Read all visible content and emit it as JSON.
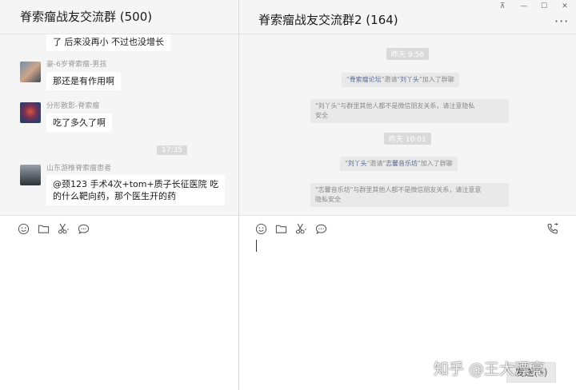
{
  "left": {
    "title": "脊索瘤战友交流群 (500)",
    "messages": [
      {
        "text": "了  后来没再小  不过也没增长"
      },
      {
        "sender": "豪-6岁脊索瘤-男孩",
        "text": "那还是有作用啊"
      },
      {
        "sender": "分形散影-脊索瘤",
        "text": "吃了多久了啊"
      },
      {
        "time": "17:35"
      },
      {
        "sender": "山东游椎脊索瘤患者",
        "text_line1": "@颈123  手术4次+tom+质子长征医院 吃",
        "text_line2": "的什么靶向药，那个医生开的药"
      }
    ]
  },
  "right": {
    "title": "脊索瘤战友交流群2 (164)",
    "more_label": "···",
    "messages": [
      {
        "time": "昨天 9:56"
      },
      {
        "q1": "\"",
        "inviter": "脊索瘤论坛",
        "q2": "\"邀请\"",
        "invitee": "刘丫头",
        "q3": "\"加入了群聊"
      },
      {
        "line1": "\"刘丫头\"与群里其他人都不是微信朋友关系，请注意隐私",
        "line2": "安全"
      },
      {
        "time": "昨天 10:01"
      },
      {
        "q1": "\"",
        "inviter": "刘丫头",
        "q2": "\"邀请\"",
        "invitee": "志馨音乐坊",
        "q3": "\"加入了群聊"
      },
      {
        "line1": "\"志馨音乐坊\"与群里其他人都不是微信朋友关系，请注意意",
        "line2": "隐私安全"
      }
    ],
    "send_label": "发送(S)"
  },
  "window": {
    "pin": "⊼",
    "minimize": "—",
    "maximize": "☐",
    "close": "✕"
  },
  "watermark": "知乎 @王大漂亮",
  "colors": {
    "link": "#576b95",
    "bg": "#f5f5f5"
  }
}
